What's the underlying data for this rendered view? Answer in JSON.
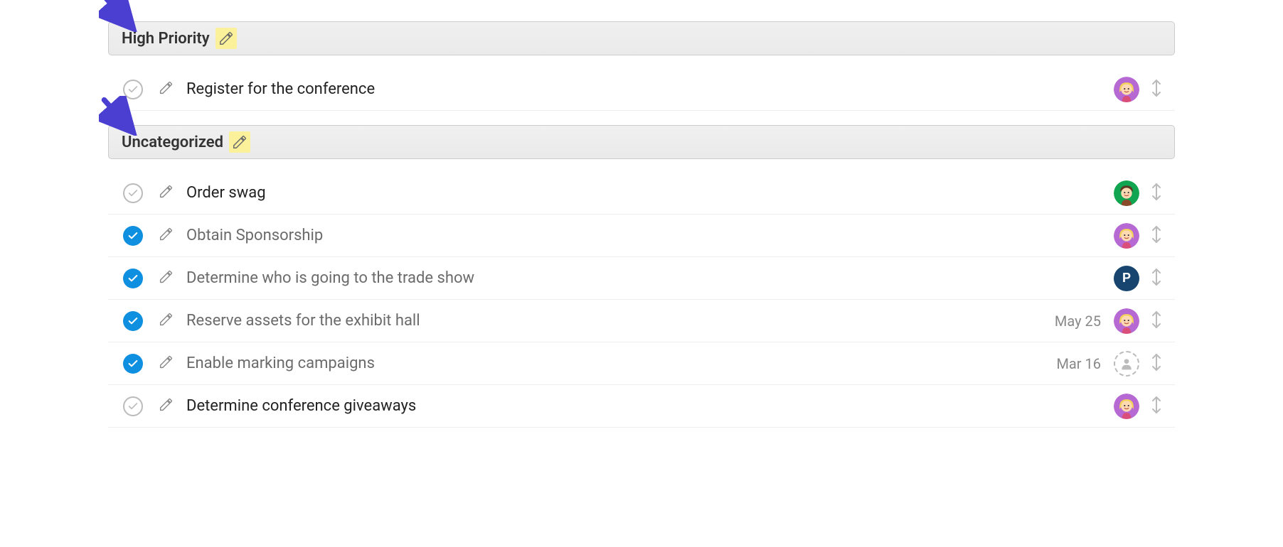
{
  "groups": [
    {
      "title": "High Priority",
      "highlightEdit": true,
      "arrowAnnotation": true,
      "tasks": [
        {
          "title": "Register for the conference",
          "done": false,
          "date": "",
          "assignee": {
            "type": "blonde",
            "bg": "#b668d3"
          }
        }
      ]
    },
    {
      "title": "Uncategorized",
      "highlightEdit": true,
      "arrowAnnotation": true,
      "tasks": [
        {
          "title": "Order swag",
          "done": false,
          "date": "",
          "assignee": {
            "type": "brunette",
            "bg": "#11a552"
          }
        },
        {
          "title": "Obtain Sponsorship",
          "done": true,
          "date": "",
          "assignee": {
            "type": "blonde",
            "bg": "#b668d3"
          }
        },
        {
          "title": "Determine who is going to the trade show",
          "done": true,
          "date": "",
          "assignee": {
            "type": "letter",
            "letter": "P",
            "bg": "#17456f"
          }
        },
        {
          "title": "Reserve assets for the exhibit hall",
          "done": true,
          "date": "May 25",
          "assignee": {
            "type": "blonde",
            "bg": "#b668d3"
          }
        },
        {
          "title": "Enable marking campaigns",
          "done": true,
          "date": "Mar 16",
          "assignee": {
            "type": "unassigned"
          }
        },
        {
          "title": "Determine conference giveaways",
          "done": false,
          "date": "",
          "assignee": {
            "type": "blonde",
            "bg": "#b668d3"
          }
        }
      ]
    }
  ]
}
